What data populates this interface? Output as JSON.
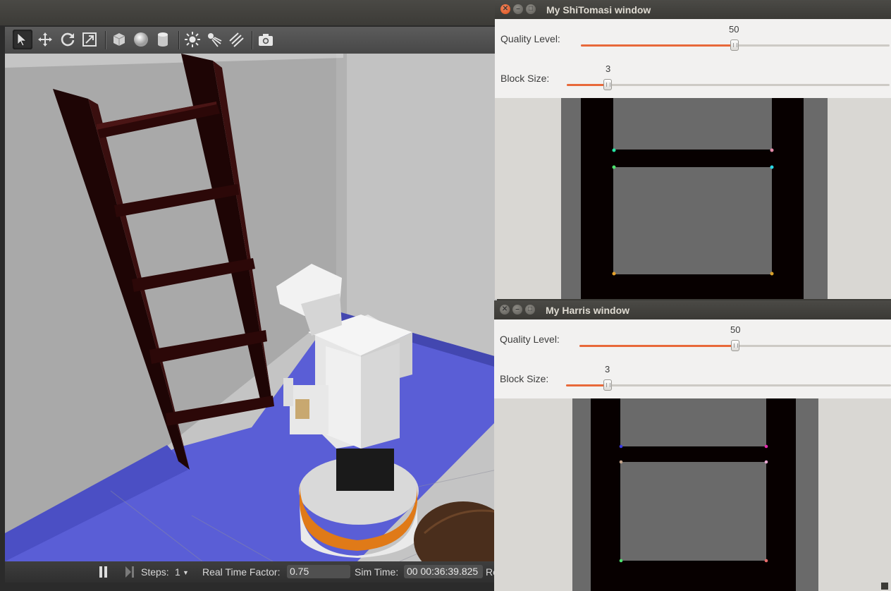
{
  "gazebo": {
    "toolbar": {
      "tools": [
        {
          "name": "select-mode",
          "icon": "arrow-icon",
          "active": true
        },
        {
          "name": "translate-mode",
          "icon": "move-icon"
        },
        {
          "name": "rotate-mode",
          "icon": "rotate-icon"
        },
        {
          "name": "scale-mode",
          "icon": "scale-icon"
        },
        {
          "name": "box-shape",
          "icon": "box-icon"
        },
        {
          "name": "sphere-shape",
          "icon": "sphere-icon"
        },
        {
          "name": "cylinder-shape",
          "icon": "cylinder-icon"
        },
        {
          "name": "point-light",
          "icon": "sun-icon"
        },
        {
          "name": "spot-light",
          "icon": "spotlight-icon"
        },
        {
          "name": "directional-light",
          "icon": "directional-light-icon"
        },
        {
          "name": "screenshot",
          "icon": "camera-icon"
        }
      ]
    },
    "status": {
      "steps_label": "Steps:",
      "steps_value": "1",
      "rtf_label": "Real Time Factor:",
      "rtf_value": "0.75",
      "sim_time_label": "Sim Time:",
      "sim_time_value": "00 00:36:39.825",
      "truncated_label": "Re"
    }
  },
  "shitomasi": {
    "title": "My ShiTomasi window",
    "quality_label": "Quality Level:",
    "quality_value": "50",
    "quality_fraction": 0.5,
    "block_label": "Block Size:",
    "block_value": "3",
    "block_fraction": 0.13
  },
  "harris": {
    "title": "My Harris window",
    "quality_label": "Quality Level:",
    "quality_value": "50",
    "quality_fraction": 0.5,
    "block_label": "Block Size:",
    "block_value": "3",
    "block_fraction": 0.13
  },
  "colors": {
    "accent": "#e8693a",
    "floor": "#5a5ed6",
    "ladder": "#2a0a0a"
  }
}
